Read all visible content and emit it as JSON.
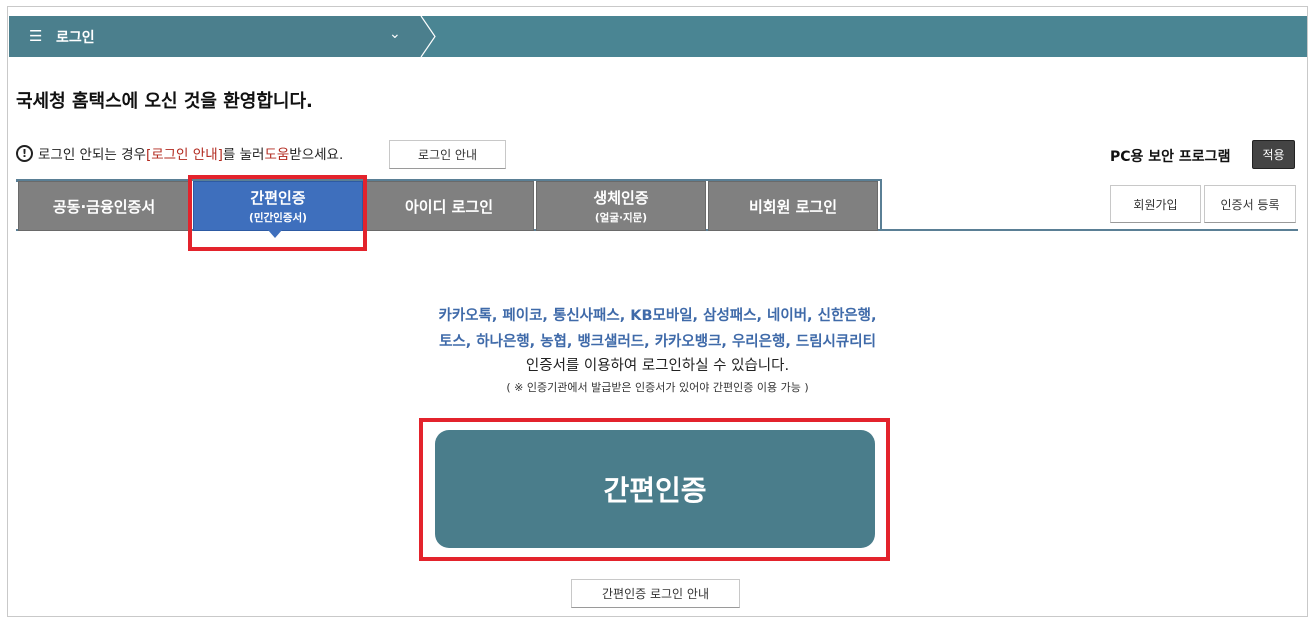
{
  "breadcrumb": {
    "menu_icon": "menu-icon",
    "label": "로그인",
    "chevron": "chevron-down-icon"
  },
  "welcome": "국세청 홈택스에 오신 것을 환영합니다.",
  "help": {
    "icon": "warning-circle-icon",
    "prefix": "로그인 안되는 경우 ",
    "link": "[로그인 안내]",
    "middle": "를 눌러 ",
    "help_word": "도움",
    "suffix": "받으세요.",
    "button": "로그인 안내"
  },
  "security": {
    "label": "PC용 보안 프로그램",
    "button": "적용"
  },
  "tabs": [
    {
      "label": "공동·금융인증서",
      "sub": ""
    },
    {
      "label": "간편인증",
      "sub": "(민간인증서)"
    },
    {
      "label": "아이디 로그인",
      "sub": ""
    },
    {
      "label": "생체인증",
      "sub": "(얼굴·지문)"
    },
    {
      "label": "비회원 로그인",
      "sub": ""
    }
  ],
  "active_tab_index": 1,
  "side_buttons": {
    "join": "회원가입",
    "cert": "인증서 등록"
  },
  "content": {
    "providers_line1": "카카오톡, 페이코, 통신사패스, KB모바일, 삼성패스, 네이버, 신한은행,",
    "providers_line2": "토스, 하나은행, 농협, 뱅크샐러드, 카카오뱅크, 우리은행, 드림시큐리티",
    "desc": "인증서를 이용하여 로그인하실 수 있습니다.",
    "note": "( ※ 인증기관에서 발급받은 인증서가 있어야 간편인증 이용 가능 )",
    "main_button": "간편인증",
    "guide_button": "간편인증 로그인 안내"
  },
  "colors": {
    "topbar": "#4a8593",
    "active_tab": "#3e6fbd",
    "tab": "#808080",
    "highlight": "#e3232c",
    "main_button": "#4a7d8b",
    "provider_text": "#3f6aa9"
  }
}
